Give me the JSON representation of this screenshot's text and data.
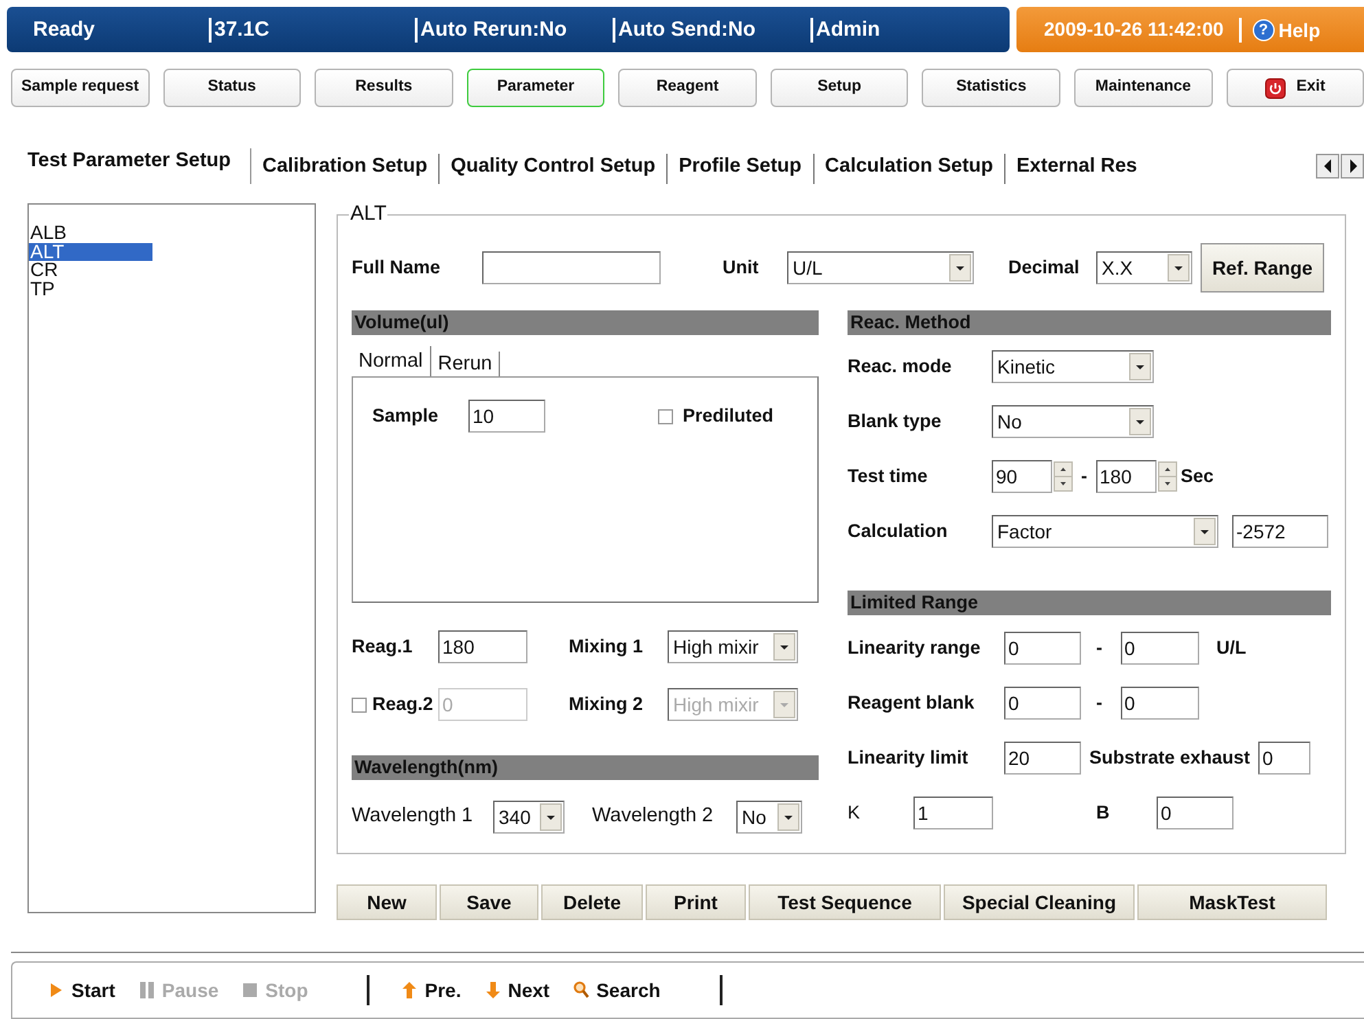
{
  "status_bar": {
    "items": [
      "Ready",
      "37.1C",
      "Auto Rerun:No",
      "Auto Send:No",
      "Admin"
    ],
    "datetime": "2009-10-26 11:42:00",
    "help": {
      "icon": "?",
      "label": "Help"
    }
  },
  "nav": [
    {
      "label": "Sample request",
      "kind": "plain",
      "selected": false
    },
    {
      "label": "Status",
      "kind": "plain",
      "selected": false
    },
    {
      "label": "Results",
      "kind": "plain",
      "selected": false
    },
    {
      "label": "Parameter",
      "kind": "plain",
      "selected": true
    },
    {
      "label": "Reagent",
      "kind": "plain",
      "selected": false
    },
    {
      "label": "Setup",
      "kind": "plain",
      "selected": false
    },
    {
      "label": "Statistics",
      "kind": "plain",
      "selected": false
    },
    {
      "label": "Maintenance",
      "kind": "plain",
      "selected": false
    },
    {
      "label": "Exit",
      "kind": "exit",
      "selected": false
    }
  ],
  "tabs": [
    {
      "label": "Test Parameter Setup",
      "selected": true
    },
    {
      "label": "Calibration Setup",
      "selected": false
    },
    {
      "label": "Quality Control Setup",
      "selected": false
    },
    {
      "label": "Profile Setup",
      "selected": false
    },
    {
      "label": "Calculation Setup",
      "selected": false
    },
    {
      "label": "External Res",
      "selected": false
    }
  ],
  "test_list": [
    {
      "label": "ALB",
      "selected": false
    },
    {
      "label": "ALT",
      "selected": true
    },
    {
      "label": "CR",
      "selected": false
    },
    {
      "label": "TP",
      "selected": false
    }
  ],
  "form": {
    "title": "ALT",
    "full_name": {
      "label": "Full Name"
    },
    "unit": {
      "label": "Unit",
      "value": "U/L"
    },
    "decimal": {
      "label": "Decimal",
      "value": "X.X"
    },
    "ref_range_button": "Ref. Range"
  },
  "volume": {
    "header": "Volume(ul)",
    "tabs": [
      {
        "label": "Normal",
        "selected": true
      },
      {
        "label": "Rerun",
        "selected": false
      }
    ],
    "sample": {
      "label": "Sample",
      "value": "10"
    },
    "prediluted": {
      "label": "Prediluted",
      "checked": false
    }
  },
  "reagents": [
    {
      "kind": "plain",
      "label": "Reag.1",
      "value": "180",
      "mixing_label": "Mixing 1",
      "mixing_value": "High mixir",
      "disabled": false
    },
    {
      "kind": "checkbox",
      "checked": false,
      "label": "Reag.2",
      "value": "0",
      "mixing_label": "Mixing 2",
      "mixing_value": "High mixir",
      "disabled": true
    }
  ],
  "wavelength": {
    "header": "Wavelength(nm)",
    "first": {
      "label": "Wavelength 1",
      "value": "340"
    },
    "second": {
      "label": "Wavelength 2",
      "value": "No"
    }
  },
  "reac_method": {
    "header": "Reac. Method",
    "reac_mode": {
      "label": "Reac. mode",
      "value": "Kinetic"
    },
    "blank_type": {
      "label": "Blank type",
      "value": "No"
    },
    "test_time": {
      "label": "Test time",
      "from": "90",
      "separator": "-",
      "to": "180",
      "unit": "Sec"
    },
    "calculation": {
      "label": "Calculation",
      "value": "Factor",
      "factor": "-2572"
    }
  },
  "limited_range": {
    "header": "Limited Range",
    "linearity_range": {
      "label": "Linearity range",
      "from": "0",
      "separator": "-",
      "to": "0",
      "unit": "U/L"
    },
    "reagent_blank": {
      "label": "Reagent blank",
      "from": "0",
      "separator": "-",
      "to": "0"
    },
    "linearity_limit": {
      "label": "Linearity limit",
      "value": "20"
    },
    "substrate_exhaust": {
      "label": "Substrate exhaust",
      "value": "0"
    },
    "k": {
      "label": "K",
      "value": "1"
    },
    "b": {
      "label": "B",
      "value": "0"
    }
  },
  "actions": [
    "New",
    "Save",
    "Delete",
    "Print",
    "Test Sequence",
    "Special Cleaning",
    "MaskTest"
  ],
  "toolbar": [
    [
      {
        "label": "Start",
        "kind": "start",
        "disabled": false
      },
      {
        "label": "Pause",
        "kind": "pause",
        "disabled": true
      },
      {
        "label": "Stop",
        "kind": "stop",
        "disabled": true
      }
    ],
    [
      {
        "label": "Pre.",
        "kind": "previous",
        "disabled": false
      },
      {
        "label": "Next",
        "kind": "next",
        "disabled": false
      },
      {
        "label": "Search",
        "kind": "search",
        "disabled": false
      }
    ]
  ]
}
